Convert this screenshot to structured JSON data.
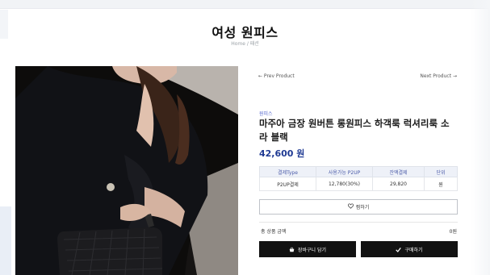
{
  "page": {
    "title": "여성 원피스",
    "breadcrumb": "Home / 패션"
  },
  "nav": {
    "prev": "← Prev Product",
    "next": "Next Product →"
  },
  "product": {
    "category": "원피스",
    "name": "마주아 금장 원버튼 롱원피스 하객룩 럭셔리룩 소라 블랙",
    "price": "42,600 원"
  },
  "price_table": {
    "headers": [
      "결제Type",
      "사용가능 P2UP",
      "잔액결제",
      "단위"
    ],
    "row": [
      "P2UP결제",
      "12,780(30%)",
      "29,820",
      "원"
    ]
  },
  "actions": {
    "wishlist": "찜하기",
    "total_label": "총 상품 금액",
    "total_value": "0원",
    "cart": "장바구니 담기",
    "buy": "구매하기"
  },
  "icons": {
    "wishlist": "heart-icon",
    "cart": "basket-icon",
    "buy": "check-icon"
  },
  "colors": {
    "accent": "#1f3a93",
    "button": "#121212",
    "category": "#5a6ccf"
  }
}
